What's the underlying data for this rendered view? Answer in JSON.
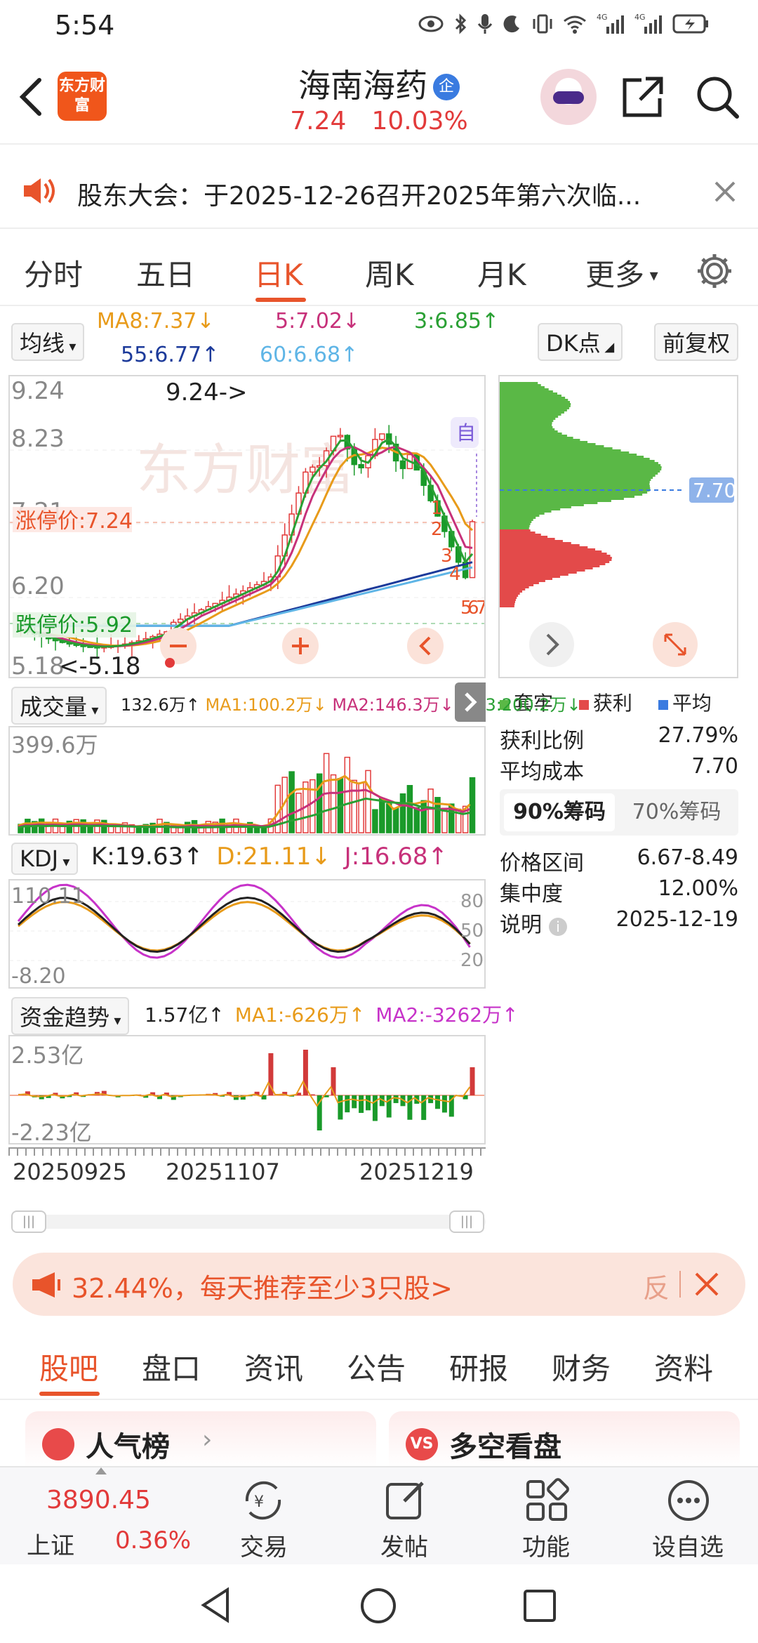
{
  "status_bar": {
    "time": "5:54",
    "net1": "4G",
    "net2": "4G"
  },
  "header": {
    "logo_text": "东方财富",
    "stock_name": "海南海药",
    "badge": "企",
    "price": "7.24",
    "change_pct": "10.03%"
  },
  "notice": {
    "text": "股东大会：于2025-12-26召开2025年第六次临..."
  },
  "period_tabs": [
    "分时",
    "五日",
    "日K",
    "周K",
    "月K",
    "更多"
  ],
  "period_active_index": 2,
  "ma_row": {
    "selector": "均线",
    "ma8": "MA8:7.37↓",
    "ma5": "5:7.02↓",
    "ma3": "3:6.85↑",
    "ma55": "55:6.77↑",
    "ma60": "60:6.68↑",
    "dk": "DK点",
    "fq": "前复权"
  },
  "kline": {
    "y_top": "9.24",
    "y_2": "8.23",
    "y_3": "7.21",
    "y_4": "6.20",
    "y_bottom": "5.18",
    "high_marker": "9.24->",
    "low_marker": "<-5.18",
    "limit_up": "涨停价:7.24",
    "limit_down": "跌停价:5.92",
    "watermark": "东方财富",
    "zi": "自",
    "seq_labels": [
      "1",
      "2",
      "3",
      "4",
      "5",
      "6",
      "7"
    ]
  },
  "chip_panel": {
    "avg_cost_tag": "7.70",
    "legend": [
      "套牢",
      "获利",
      "平均"
    ],
    "legend_colors": [
      "#5ab846",
      "#e34a4a",
      "#3a7be0"
    ],
    "profit_ratio_label": "获利比例",
    "profit_ratio": "27.79%",
    "avg_cost_label": "平均成本",
    "avg_cost": "7.70",
    "chip_tabs": [
      "90%筹码",
      "70%筹码"
    ],
    "range_label": "价格区间",
    "range": "6.67-8.49",
    "concentration_label": "集中度",
    "concentration": "12.00%",
    "note_label": "说明",
    "note_date": "2025-12-19"
  },
  "volume": {
    "selector": "成交量",
    "vol": "132.6万↑",
    "ma1": "MA1:100.2万↓",
    "ma2": "MA2:146.3万↓",
    "ma3": "MA3:200.2万↓",
    "y_top": "399.6万"
  },
  "kdj": {
    "selector": "KDJ",
    "k": "K:19.63↑",
    "d": "D:21.11↓",
    "j": "J:16.68↑",
    "y_top": "110.11",
    "y_bottom": "-8.20",
    "levels": [
      "80",
      "50",
      "20"
    ]
  },
  "fund": {
    "selector": "资金趋势",
    "value": "1.57亿↑",
    "ma1": "MA1:-626万↑",
    "ma2": "MA2:-3262万↑",
    "y_top": "2.53亿",
    "y_bottom": "-2.23亿"
  },
  "dates": [
    "20250925",
    "20251107",
    "20251219"
  ],
  "promo": {
    "text": "32.44%，每天推荐至少3只股>",
    "feedback": "反"
  },
  "section_tabs": [
    "股吧",
    "盘口",
    "资讯",
    "公告",
    "研报",
    "财务",
    "资料"
  ],
  "section_active_index": 0,
  "cards": {
    "left_title": "人气榜",
    "right_title": "多空看盘"
  },
  "bottom_nav": {
    "index_value": "3890.45",
    "index_name": "上证",
    "index_change": "0.36%",
    "items": [
      "交易",
      "发帖",
      "功能",
      "设自选"
    ]
  },
  "colors": {
    "accent": "#e8542b",
    "up": "#e23a3a",
    "down": "#1a9a2a"
  }
}
